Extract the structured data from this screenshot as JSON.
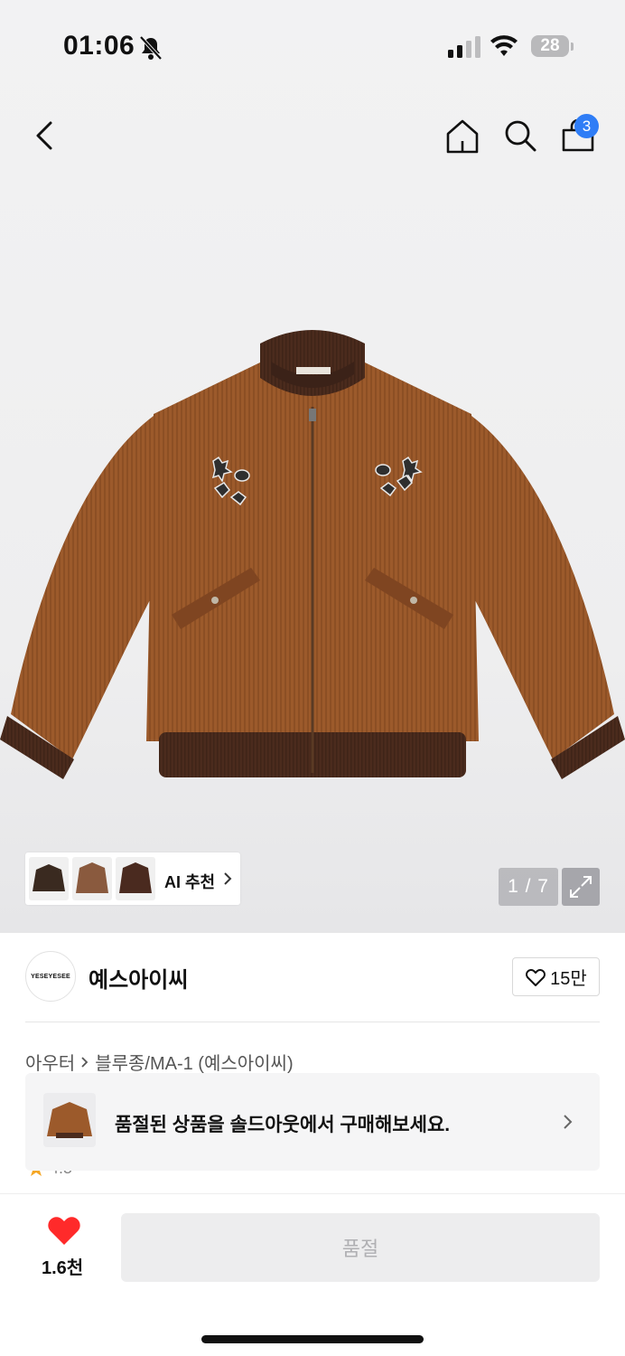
{
  "status_bar": {
    "time": "01:06",
    "battery": "28"
  },
  "nav": {
    "cart_count": "3"
  },
  "gallery": {
    "ai_label": "AI 추천",
    "counter": "1 / 7"
  },
  "brand": {
    "logo_text": "YESEYESEE",
    "name": "예스아이씨",
    "likes": "15만"
  },
  "breadcrumb": {
    "category": "아우터",
    "subcategory": "블루종/MA-1 (예스아이씨)"
  },
  "peek_text": "4.5",
  "toast": {
    "message": "품절된 상품을 솔드아웃에서 구매해보세요."
  },
  "bottom_bar": {
    "like_count": "1.6천",
    "buy_label": "품절"
  },
  "colors": {
    "accent_blue": "#2f7df6",
    "heart_red": "#ff2a2a",
    "jacket_brown": "#9a5a2c",
    "rib_brown": "#4a2a1c"
  },
  "icons": [
    "back-arrow-icon",
    "home-icon",
    "search-icon",
    "cart-icon",
    "heart-icon",
    "chevron-right-icon",
    "expand-icon",
    "bell-slash-icon",
    "signal-icon",
    "wifi-icon"
  ]
}
